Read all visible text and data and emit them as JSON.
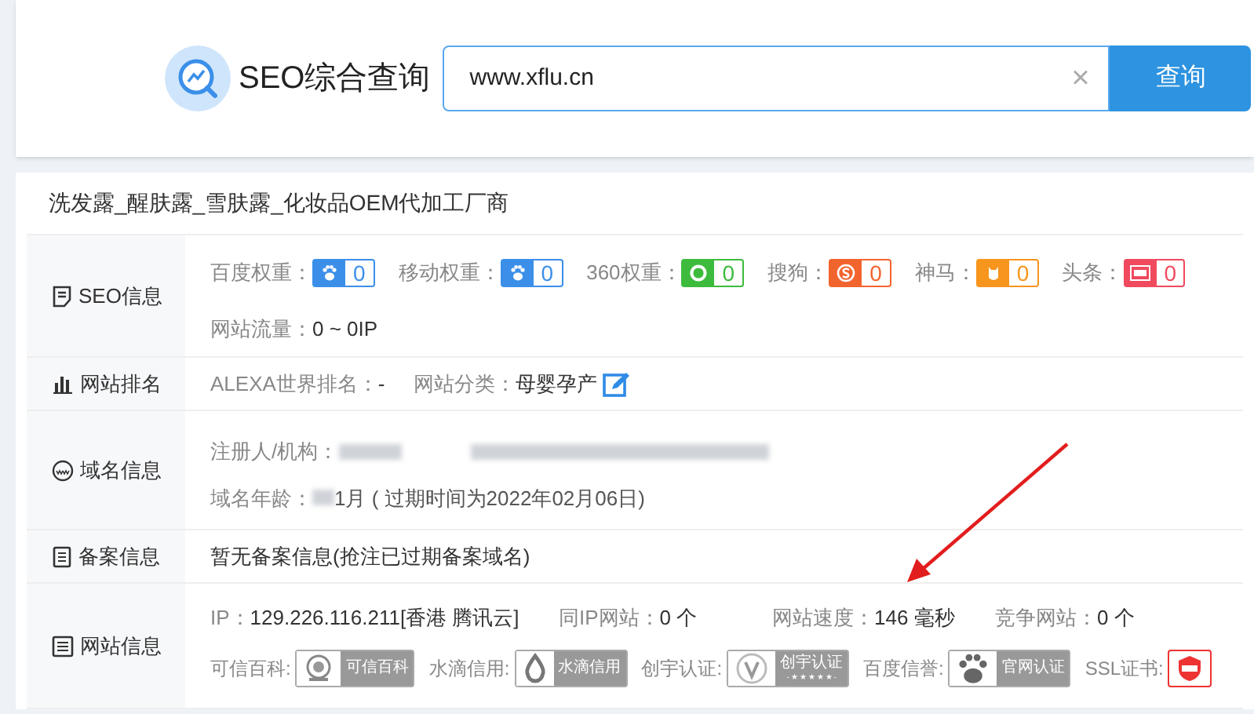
{
  "header": {
    "title": "SEO综合查询",
    "search_value": "www.xflu.cn",
    "clear_symbol": "×",
    "search_button": "查询"
  },
  "site_title": "洗发露_醒肤露_雪肤露_化妆品OEM代加工厂商",
  "sections": [
    {
      "kind": "seo",
      "label": "SEO信息",
      "weights": [
        {
          "label": "百度权重：",
          "value": "0",
          "color": "#3b8fe9",
          "kind": "paw"
        },
        {
          "label": "移动权重：",
          "value": "0",
          "color": "#3b8fe9",
          "kind": "paw"
        },
        {
          "label": "360权重：",
          "value": "0",
          "color": "#3dbb3d",
          "kind": "ring"
        },
        {
          "label": "搜狗：",
          "value": "0",
          "color": "#f2642e",
          "kind": "s"
        },
        {
          "label": "神马：",
          "value": "0",
          "color": "#f7951d",
          "kind": "owl"
        },
        {
          "label": "头条：",
          "value": "0",
          "color": "#f04a5e",
          "kind": "news"
        }
      ],
      "traffic_label": "网站流量：",
      "traffic_value": "0 ~ 0IP"
    },
    {
      "kind": "rank",
      "label": "网站排名",
      "fields": [
        {
          "label": "ALEXA世界排名：",
          "value": "-"
        },
        {
          "label": "网站分类：",
          "value": "母婴孕产"
        }
      ]
    },
    {
      "kind": "domain",
      "label": "域名信息",
      "registrant_label": "注册人/机构：",
      "age_label": "域名年龄：",
      "age_value": "1月 ( 过期时间为2022年02月06日)"
    },
    {
      "kind": "icp",
      "label": "备案信息",
      "text": "暂无备案信息(抢注已过期备案域名)"
    },
    {
      "kind": "info",
      "label": "网站信息",
      "fields": [
        {
          "label": "IP：",
          "value": "129.226.116.211[香港 腾讯云]"
        },
        {
          "label": "同IP网站：",
          "value": "0 个"
        },
        {
          "label": "网站速度：",
          "value": "146 毫秒"
        },
        {
          "label": "竞争网站：",
          "value": "0 个"
        }
      ],
      "certs": [
        {
          "label": "可信百科:",
          "kind": "seal",
          "badge": "可信百科"
        },
        {
          "label": "水滴信用:",
          "kind": "drop",
          "badge": "水滴信用"
        },
        {
          "label": "创宇认证:",
          "kind": "v",
          "badge": "创宇认证",
          "rating": "- ★ ★ ★ ★ ★ -"
        },
        {
          "label": "百度信誉:",
          "kind": "paw",
          "badge": "官网认证"
        },
        {
          "label": "SSL证书:",
          "kind": "ssl"
        }
      ]
    }
  ]
}
